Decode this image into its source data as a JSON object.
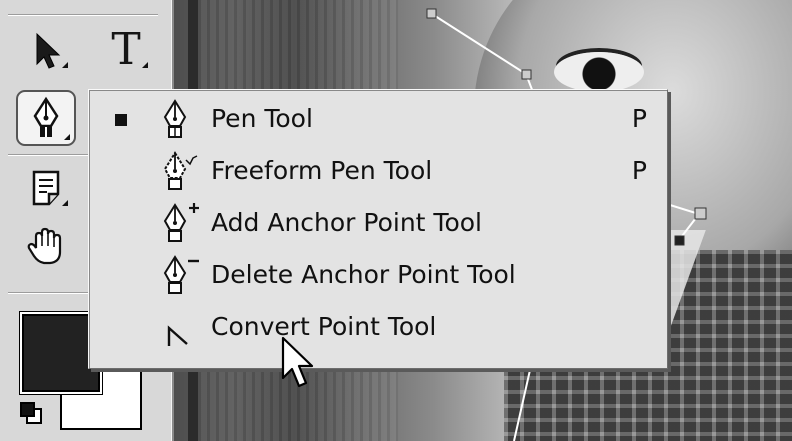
{
  "toolbox": {
    "type_tool_glyph": "T",
    "icons": [
      "selection-arrow-icon",
      "type-tool-icon",
      "pen-tool-icon",
      "notes-tool-icon",
      "hand-tool-icon",
      "default-colors-icon"
    ],
    "foreground_color": "#222222",
    "background_color": "#ffffff"
  },
  "pen_flyout_menu": {
    "items": [
      {
        "label": "Pen Tool",
        "shortcut": "P",
        "icon": "pen-icon",
        "selected": true
      },
      {
        "label": "Freeform Pen Tool",
        "shortcut": "P",
        "icon": "freeform-pen-icon",
        "selected": false
      },
      {
        "label": "Add Anchor Point Tool",
        "shortcut": "",
        "icon": "add-anchor-pen-icon",
        "selected": false
      },
      {
        "label": "Delete Anchor Point Tool",
        "shortcut": "",
        "icon": "delete-anchor-pen-icon",
        "selected": false
      },
      {
        "label": "Convert Point Tool",
        "shortcut": "",
        "icon": "convert-point-icon",
        "selected": false
      }
    ]
  }
}
